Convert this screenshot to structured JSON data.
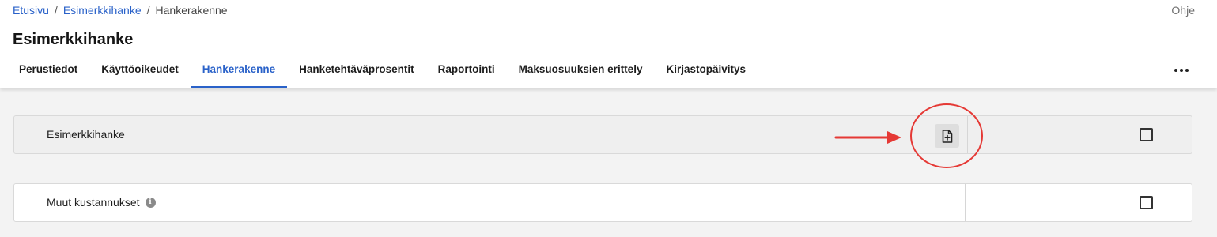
{
  "breadcrumb": {
    "items": [
      {
        "label": "Etusivu"
      },
      {
        "label": "Esimerkkihanke"
      },
      {
        "label": "Hankerakenne"
      }
    ],
    "separator": "/"
  },
  "help_label": "Ohje",
  "page_title": "Esimerkkihanke",
  "tabs": [
    {
      "label": "Perustiedot"
    },
    {
      "label": "Käyttöoikeudet"
    },
    {
      "label": "Hankerakenne",
      "active": true
    },
    {
      "label": "Hanketehtäväprosentit"
    },
    {
      "label": "Raportointi"
    },
    {
      "label": "Maksuosuuksien erittely"
    },
    {
      "label": "Kirjastopäivitys"
    }
  ],
  "more_icon": "more-horizontal-icon",
  "rows": [
    {
      "label": "Esimerkkihanke",
      "action_icon": "add-document-icon",
      "checked": false
    },
    {
      "label": "Muut kustannukset",
      "info_icon": "info-icon",
      "info_glyph": "i",
      "checked": false
    }
  ],
  "colors": {
    "accent": "#2a62c9",
    "annotation": "#e53935",
    "background": "#f3f3f3"
  }
}
